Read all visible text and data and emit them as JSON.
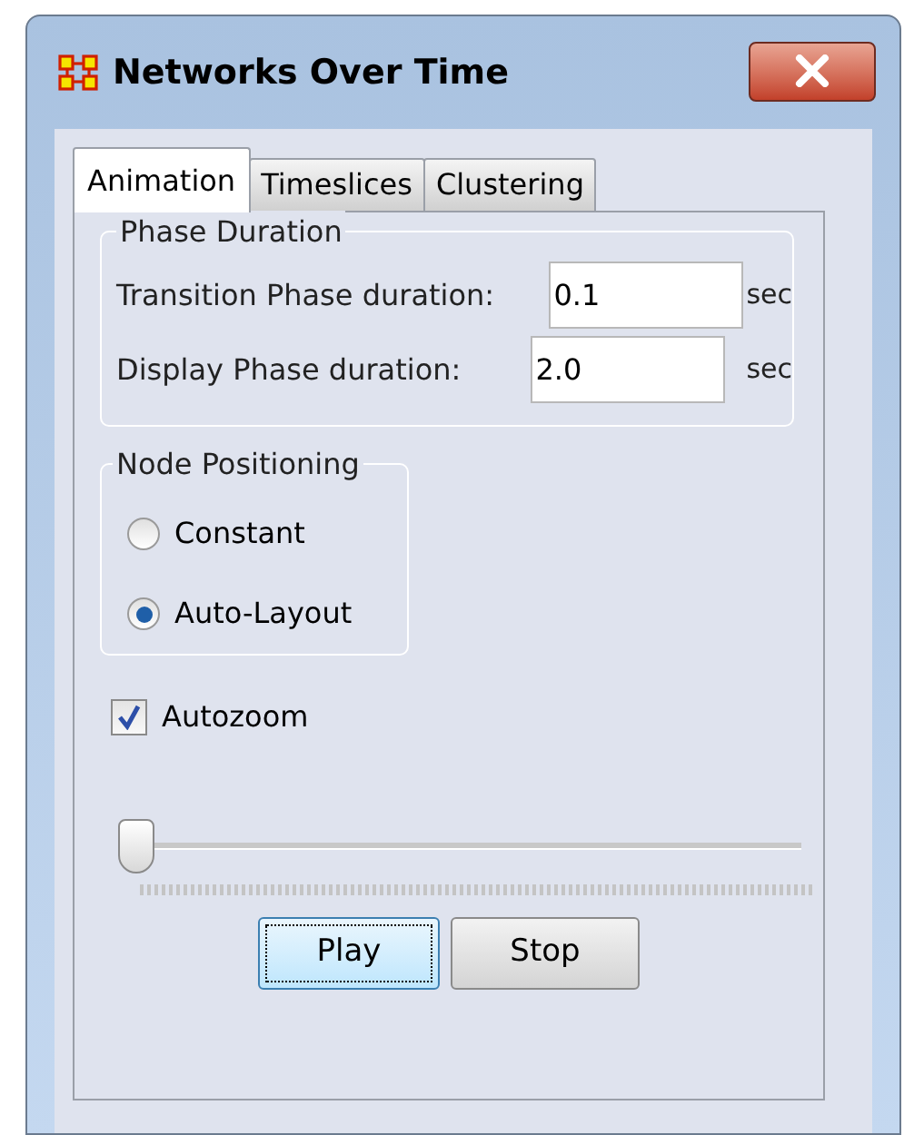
{
  "window": {
    "title": "Networks Over Time"
  },
  "tabs": [
    {
      "label": "Animation",
      "selected": true
    },
    {
      "label": "Timeslices",
      "selected": false
    },
    {
      "label": "Clustering",
      "selected": false
    }
  ],
  "phase_duration": {
    "title": "Phase Duration",
    "fields": [
      {
        "label": "Transition Phase duration:",
        "value": "0.1",
        "unit": "sec"
      },
      {
        "label": "Display Phase duration:",
        "value": "2.0",
        "unit": "sec"
      }
    ]
  },
  "node_positioning": {
    "title": "Node Positioning",
    "options": [
      {
        "label": "Constant",
        "selected": false
      },
      {
        "label": "Auto-Layout",
        "selected": true
      }
    ]
  },
  "autozoom": {
    "label": "Autozoom",
    "checked": true
  },
  "slider": {
    "level": 0
  },
  "buttons": [
    {
      "label": "Play",
      "focused": true
    },
    {
      "label": "Stop",
      "focused": false
    }
  ]
}
